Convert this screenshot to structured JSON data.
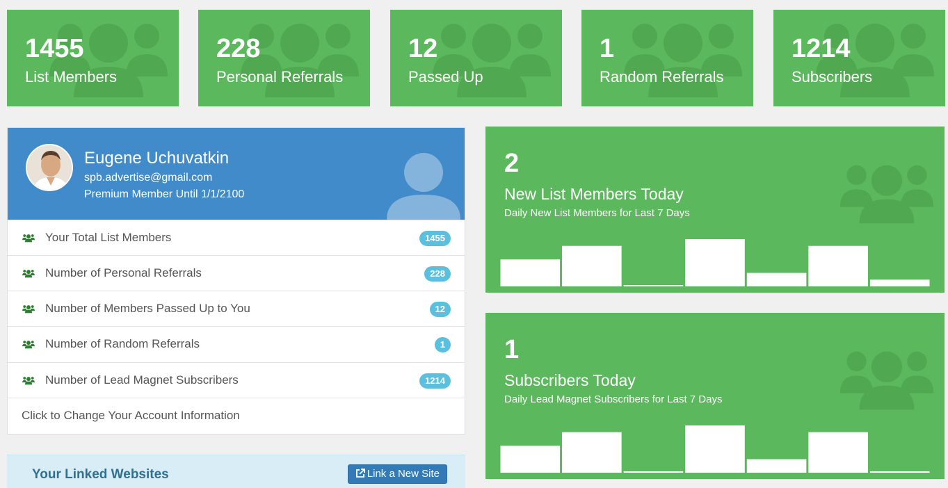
{
  "stats": [
    {
      "value": "1455",
      "label": "List Members"
    },
    {
      "value": "228",
      "label": "Personal Referrals"
    },
    {
      "value": "12",
      "label": "Passed Up"
    },
    {
      "value": "1",
      "label": "Random Referrals"
    },
    {
      "value": "1214",
      "label": "Subscribers"
    }
  ],
  "profile": {
    "name": "Eugene Uchuvatkin",
    "email": "spb.advertise@gmail.com",
    "membership": "Premium Member Until 1/1/2100",
    "rows": [
      {
        "label": "Your Total List Members",
        "count": "1455"
      },
      {
        "label": "Number of Personal Referrals",
        "count": "228"
      },
      {
        "label": "Number of Members Passed Up to You",
        "count": "12"
      },
      {
        "label": "Number of Random Referrals",
        "count": "1"
      },
      {
        "label": "Number of Lead Magnet Subscribers",
        "count": "1214"
      }
    ],
    "change_account": "Click to Change Your Account Information"
  },
  "linked_sites": {
    "title": "Your Linked Websites",
    "button_label": "Link a New Site"
  },
  "panels": [
    {
      "value": "2",
      "title": "New List Members Today",
      "subtitle": "Daily New List Members for Last 7 Days"
    },
    {
      "value": "1",
      "title": "Subscribers Today",
      "subtitle": "Daily Lead Magnet Subscribers for Last 7 Days"
    }
  ],
  "chart_data": [
    {
      "type": "bar",
      "values": [
        2,
        3,
        0,
        3.5,
        1,
        3,
        0.5
      ],
      "ylim": [
        0,
        3.5
      ]
    },
    {
      "type": "bar",
      "values": [
        2,
        3,
        0,
        3.5,
        1,
        3,
        0
      ],
      "ylim": [
        0,
        3.5
      ]
    }
  ],
  "colors": {
    "green": "#5cb85c",
    "blue": "#428bca",
    "badge": "#5bc0de",
    "button": "#337ab7",
    "info_bg": "#d9edf7"
  },
  "icons": {
    "stat_bg": "users-icon",
    "row": "users-icon",
    "button": "external-link-icon"
  }
}
